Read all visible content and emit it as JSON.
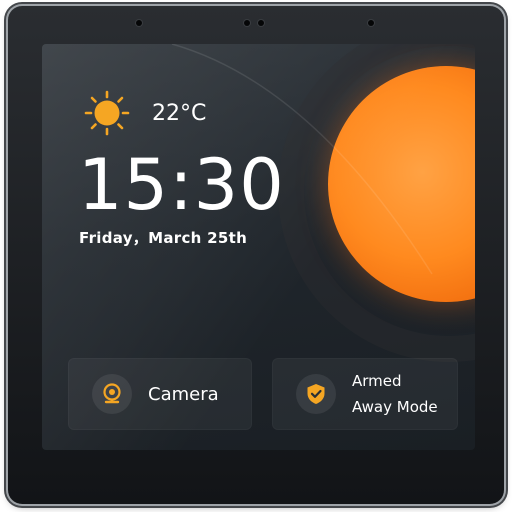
{
  "weather": {
    "icon": "sun-icon",
    "temperature": "22°C"
  },
  "clock": {
    "time": "15:30",
    "date": "Friday，March 25th"
  },
  "cards": {
    "camera": {
      "icon": "camera-icon",
      "label": "Camera"
    },
    "security": {
      "icon": "shield-check-icon",
      "line1": "Armed",
      "line2": "Away Mode"
    }
  },
  "colors": {
    "accent": "#ff8a1f",
    "icon_accent": "#f5a623",
    "screen_bg": "#23292f"
  }
}
